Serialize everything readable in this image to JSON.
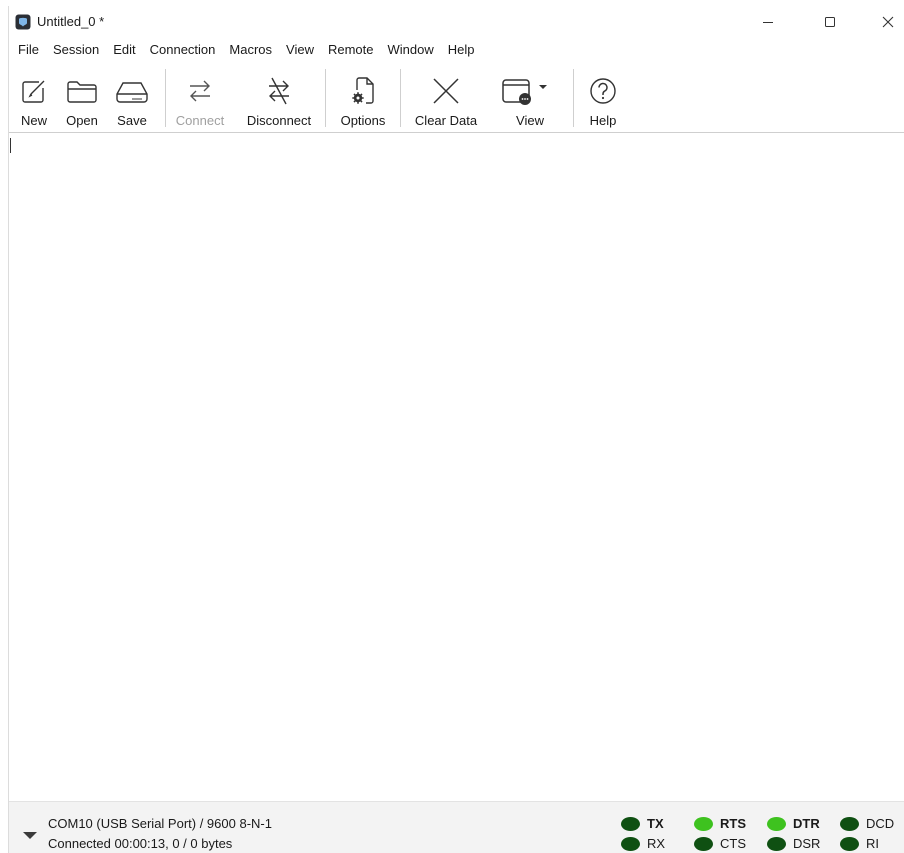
{
  "window": {
    "title": "Untitled_0 *"
  },
  "menu": [
    "File",
    "Session",
    "Edit",
    "Connection",
    "Macros",
    "View",
    "Remote",
    "Window",
    "Help"
  ],
  "toolbar": {
    "new_label": "New",
    "open_label": "Open",
    "save_label": "Save",
    "connect_label": "Connect",
    "disconnect_label": "Disconnect",
    "options_label": "Options",
    "clear_label": "Clear Data",
    "view_label": "View",
    "help_label": "Help"
  },
  "status": {
    "port_info": "COM10 (USB Serial Port) / 9600 8-N-1",
    "connection_info": "Connected 00:00:13, 0 / 0 bytes"
  },
  "signals": {
    "tx": {
      "label": "TX",
      "color": "#0f5012"
    },
    "rx": {
      "label": "RX",
      "color": "#0f5012"
    },
    "rts": {
      "label": "RTS",
      "color": "#3ec21f"
    },
    "cts": {
      "label": "CTS",
      "color": "#0f5012"
    },
    "dtr": {
      "label": "DTR",
      "color": "#3ec21f"
    },
    "dsr": {
      "label": "DSR",
      "color": "#0f5012"
    },
    "dcd": {
      "label": "DCD",
      "color": "#0f5012"
    },
    "ri": {
      "label": "RI",
      "color": "#0f5012"
    }
  },
  "icons": {
    "app": "terminal-app-icon",
    "new": "edit-icon",
    "open": "folder-icon",
    "save": "drive-icon",
    "connect": "connect-arrows-icon",
    "disconnect": "disconnect-arrows-icon",
    "options": "settings-document-icon",
    "clear": "x-icon",
    "view": "window-view-icon",
    "help": "question-circle-icon"
  }
}
